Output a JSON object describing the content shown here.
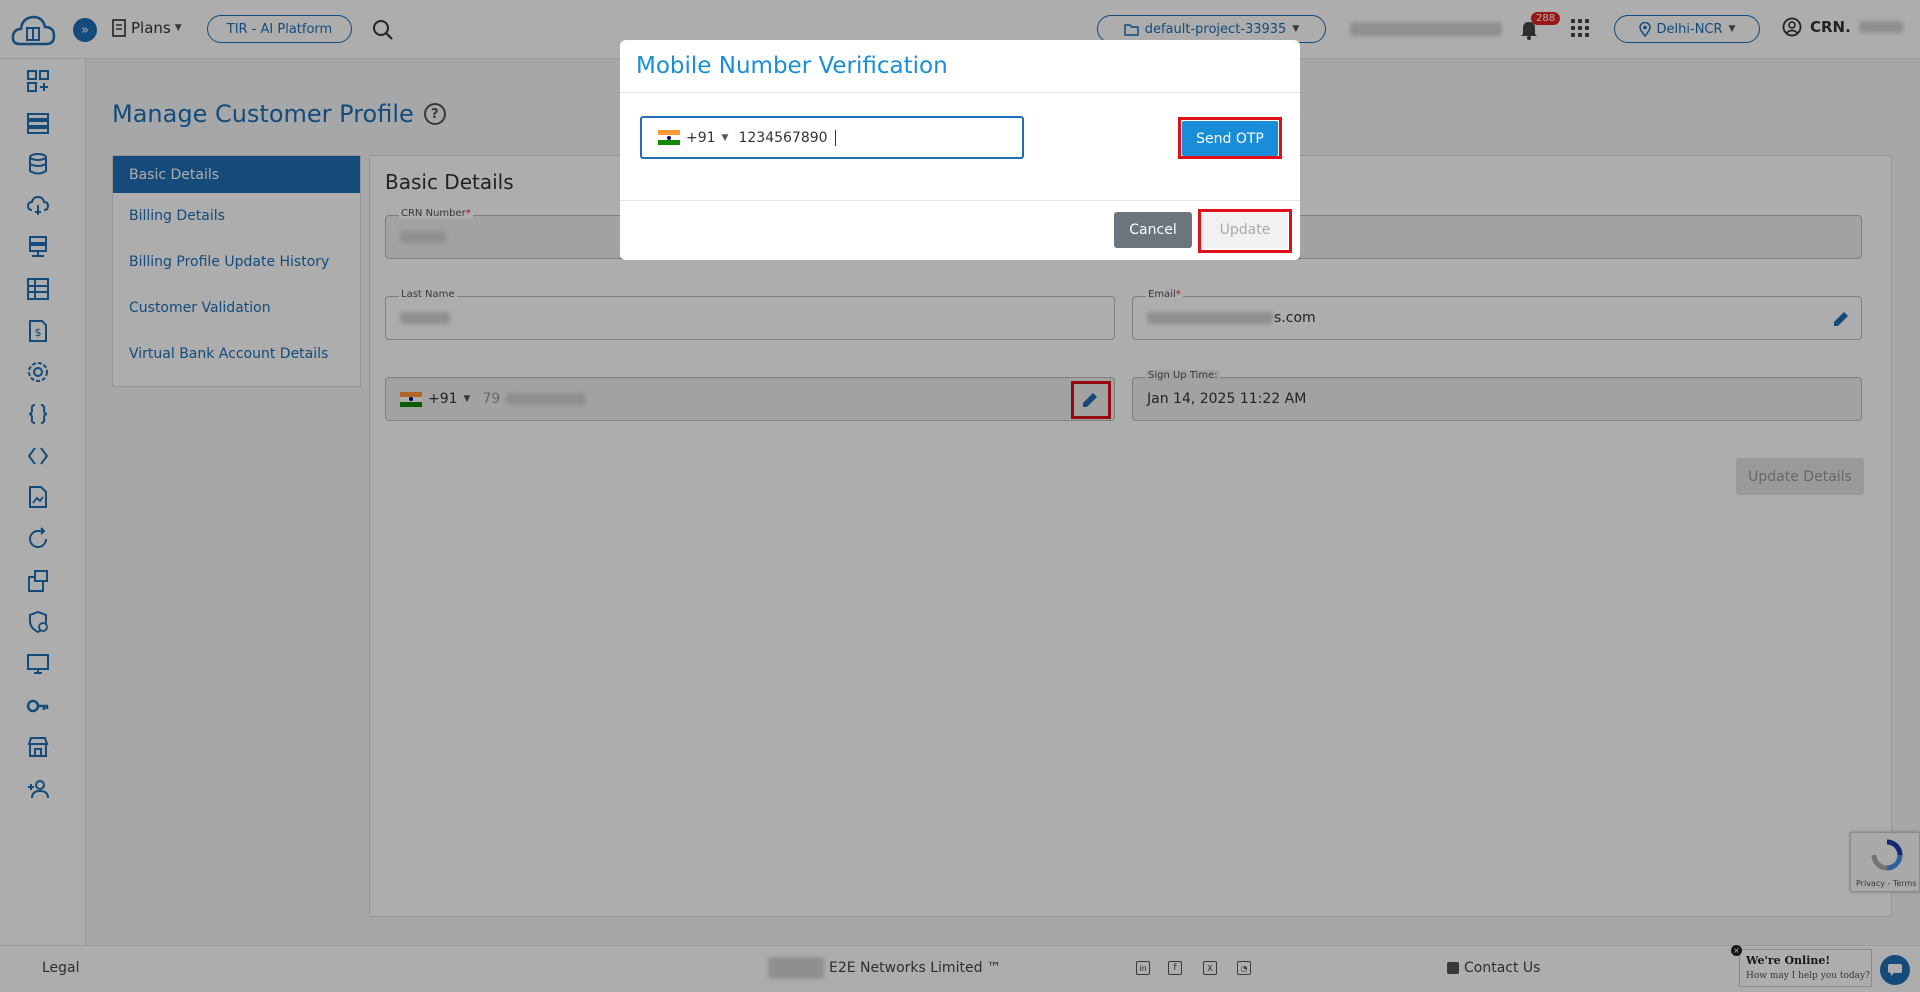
{
  "header": {
    "plans_label": "Plans",
    "platform_pill": "TIR - AI Platform",
    "project_selector": "default-project-33935",
    "notification_count": "288",
    "region": "Delhi-NCR",
    "crn_label": "CRN."
  },
  "page": {
    "title": "Manage Customer Profile",
    "section_title": "Basic Details"
  },
  "left_menu": {
    "items": [
      {
        "label": "Basic Details"
      },
      {
        "label": "Billing Details"
      },
      {
        "label": "Billing Profile Update History"
      },
      {
        "label": "Customer Validation"
      },
      {
        "label": "Virtual Bank Account Details"
      }
    ]
  },
  "form": {
    "crn_label": "CRN Number",
    "last_name_label": "Last Name",
    "email_label": "Email",
    "email_suffix": "s.com",
    "phone_code": "+91",
    "phone_prefix": "79",
    "signup_label": "Sign Up Time:",
    "signup_value": "Jan 14, 2025 11:22 AM",
    "update_details_label": "Update Details",
    "required_mark": "*"
  },
  "modal": {
    "title": "Mobile Number Verification",
    "country_code": "+91",
    "phone_value": "1234567890",
    "send_otp_label": "Send OTP",
    "cancel_label": "Cancel",
    "update_label": "Update"
  },
  "footer": {
    "legal": "Legal",
    "company": "E2E Networks Limited ™",
    "contact": "Contact Us"
  },
  "chat": {
    "title": "We're Online!",
    "subtitle": "How may I help you today?"
  },
  "recaptcha": {
    "text": "Privacy - Terms"
  },
  "colors": {
    "brand": "#1e6fb5",
    "highlight": "#e0101a",
    "primary_button": "#1a8dd8"
  }
}
